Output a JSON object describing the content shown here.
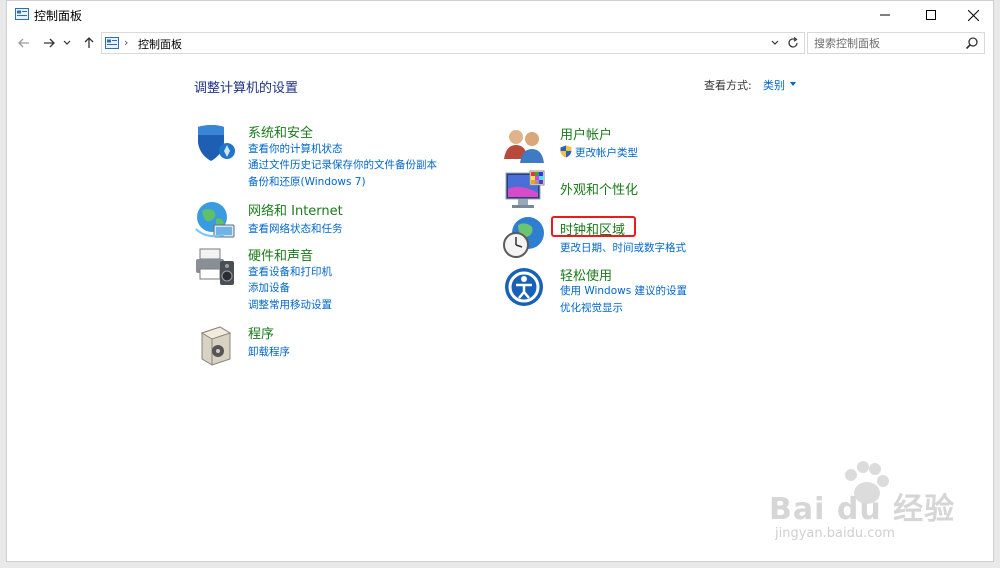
{
  "window": {
    "title": "控制面板",
    "minimize_glyph": "—",
    "maximize_glyph": "☐",
    "close_glyph": "✕"
  },
  "address": {
    "crumb": "控制面板",
    "separator": "›",
    "search_placeholder": "搜索控制面板"
  },
  "main": {
    "heading": "调整计算机的设置",
    "view_by_label": "查看方式:",
    "view_by_value": "类别"
  },
  "categories_left": [
    {
      "title": "系统和安全",
      "icon": "shield-icon",
      "links": [
        "查看你的计算机状态",
        "通过文件历史记录保存你的文件备份副本",
        "备份和还原(Windows 7)"
      ]
    },
    {
      "title": "网络和 Internet",
      "icon": "network-globe-icon",
      "links": [
        "查看网络状态和任务"
      ]
    },
    {
      "title": "硬件和声音",
      "icon": "printer-speaker-icon",
      "links": [
        "查看设备和打印机",
        "添加设备",
        "调整常用移动设置"
      ]
    },
    {
      "title": "程序",
      "icon": "programs-box-icon",
      "links": [
        "卸载程序"
      ]
    }
  ],
  "categories_right": [
    {
      "title": "用户帐户",
      "icon": "users-icon",
      "links": [
        "更改帐户类型"
      ]
    },
    {
      "title": "外观和个性化",
      "icon": "monitor-palette-icon",
      "links": []
    },
    {
      "title": "时钟和区域",
      "icon": "clock-globe-icon",
      "links": [
        "更改日期、时间或数字格式"
      ]
    },
    {
      "title": "轻松使用",
      "icon": "ease-of-access-icon",
      "links": [
        "使用 Windows 建议的设置",
        "优化视觉显示"
      ]
    }
  ],
  "watermark": {
    "logo": "Bai du 经验",
    "sub": "jingyan.baidu.com"
  },
  "colors": {
    "title_green": "#1a7a1a",
    "link_blue": "#0066cc",
    "heading_blue": "#1e3287",
    "highlight_red": "#e81c1c"
  }
}
